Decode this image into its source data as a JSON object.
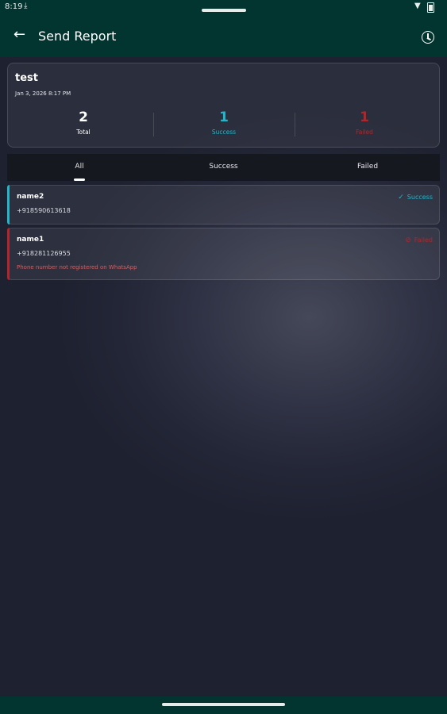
{
  "status_bar": {
    "time": "8:19"
  },
  "app_bar": {
    "title": "Send Report"
  },
  "summary": {
    "name": "test",
    "date": "Jan 3, 2026 8:17 PM",
    "stats": [
      {
        "value": "2",
        "label": "Total",
        "color": "#ffffff"
      },
      {
        "value": "1",
        "label": "Success",
        "color": "#22b6c9"
      },
      {
        "value": "1",
        "label": "Failed",
        "color": "#b3252a"
      }
    ]
  },
  "tabs": [
    {
      "label": "All",
      "active": true
    },
    {
      "label": "Success",
      "active": false
    },
    {
      "label": "Failed",
      "active": false
    }
  ],
  "results": [
    {
      "name": "name2",
      "phone": "+918590613618",
      "status": "Success",
      "status_color": "#22b6c9",
      "error": ""
    },
    {
      "name": "name1",
      "phone": "+918281126955",
      "status": "Failed",
      "status_color": "#b3252a",
      "error": "Phone number not registered on WhatsApp"
    }
  ],
  "colors": {
    "app_bar": "#033530",
    "success": "#22b6c9",
    "failed": "#b3252a"
  },
  "icons": {
    "back": "arrow-left-icon",
    "history": "history-clock-icon",
    "success": "check-icon",
    "failed": "cancel-circle-icon"
  }
}
